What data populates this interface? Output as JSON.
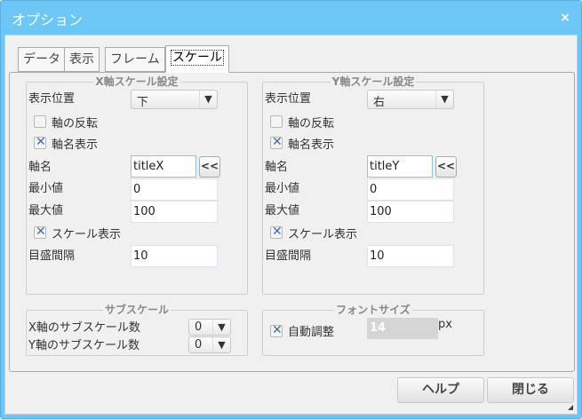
{
  "window": {
    "title": "オプション",
    "close_icon": "×"
  },
  "tabs": [
    "データ",
    "表示",
    "フレーム",
    "スケール"
  ],
  "x_axis": {
    "legend": "X軸スケール設定",
    "position_label": "表示位置",
    "position_value": "下",
    "invert_label": "軸の反転",
    "invert_checked": false,
    "show_name_label": "軸名表示",
    "show_name_checked": true,
    "name_label": "軸名",
    "name_value": "titleX",
    "name_button": "<<",
    "min_label": "最小値",
    "min_value": "0",
    "max_label": "最大値",
    "max_value": "100",
    "show_scale_label": "スケール表示",
    "show_scale_checked": true,
    "tick_label": "目盛間隔",
    "tick_value": "10"
  },
  "y_axis": {
    "legend": "Y軸スケール設定",
    "position_label": "表示位置",
    "position_value": "右",
    "invert_label": "軸の反転",
    "invert_checked": false,
    "show_name_label": "軸名表示",
    "show_name_checked": true,
    "name_label": "軸名",
    "name_value": "titleY",
    "name_button": "<<",
    "min_label": "最小値",
    "min_value": "0",
    "max_label": "最大値",
    "max_value": "100",
    "show_scale_label": "スケール表示",
    "show_scale_checked": true,
    "tick_label": "目盛間隔",
    "tick_value": "10"
  },
  "subscale": {
    "legend": "サブスケール",
    "x_label": "X軸のサブスケール数",
    "x_value": "0",
    "y_label": "Y軸のサブスケール数",
    "y_value": "0"
  },
  "fontsize": {
    "legend": "フォントサイズ",
    "auto_label": "自動調整",
    "auto_checked": true,
    "value": "14",
    "unit": "px"
  },
  "buttons": {
    "help": "ヘルプ",
    "close": "閉じる"
  },
  "dropdown_arrow": "▼"
}
